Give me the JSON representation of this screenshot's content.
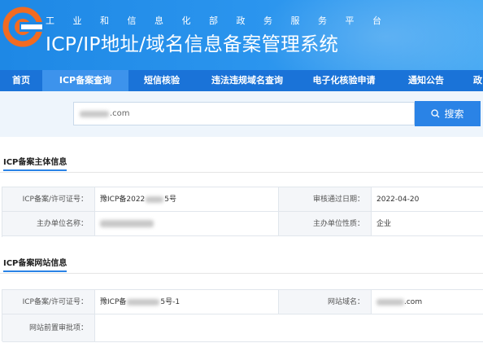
{
  "header": {
    "subtitle": "工业和信息化部政务服务平台",
    "title": "ICP/IP地址/域名信息备案管理系统"
  },
  "nav": {
    "items": [
      {
        "label": "首页",
        "active": false
      },
      {
        "label": "ICP备案查询",
        "active": true
      },
      {
        "label": "短信核验",
        "active": false
      },
      {
        "label": "违法违规域名查询",
        "active": false
      },
      {
        "label": "电子化核验申请",
        "active": false
      },
      {
        "label": "通知公告",
        "active": false
      },
      {
        "label": "政",
        "active": false
      }
    ]
  },
  "search": {
    "value": ".com",
    "button_label": "搜索"
  },
  "subject_section": {
    "title": "ICP备案主体信息",
    "rows": [
      {
        "label1": "ICP备案/许可证号：",
        "value1": "豫ICP备2022",
        "value1_tail": "5号",
        "label2": "审核通过日期：",
        "value2": "2022-04-20"
      },
      {
        "label1": "主办单位名称：",
        "value1": "",
        "value1_tail": "",
        "label2": "主办单位性质：",
        "value2": "企业"
      }
    ]
  },
  "website_section": {
    "title": "ICP备案网站信息",
    "rows": [
      {
        "label1": "ICP备案/许可证号：",
        "value1": "豫ICP备",
        "value1_tail": "5号-1",
        "label2": "网站域名：",
        "value2": ".com"
      },
      {
        "label1": "网站前置审批项：",
        "value1": ""
      }
    ]
  },
  "colors": {
    "header_blue": "#1e88e5",
    "nav_blue": "#1a73d8",
    "accent": "#2a83e6",
    "logo_orange": "#f26b21"
  }
}
